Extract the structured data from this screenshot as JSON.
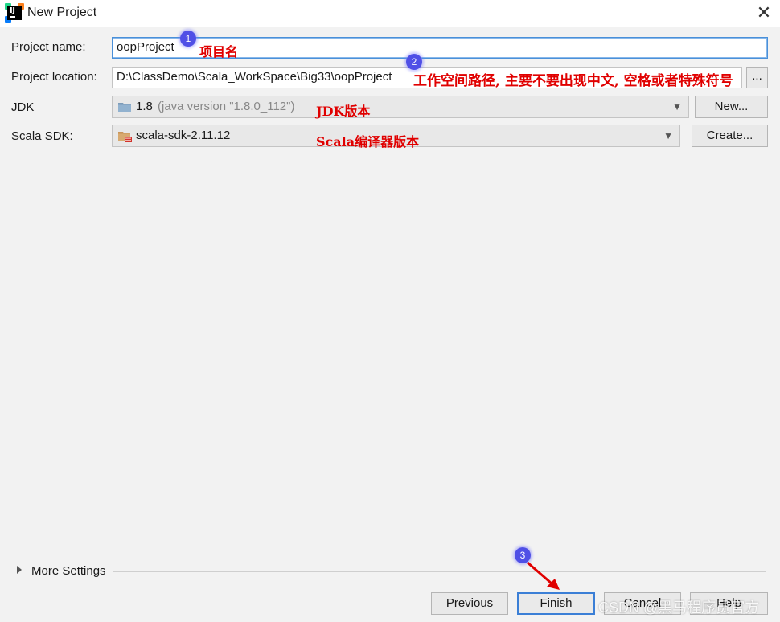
{
  "window": {
    "title": "New Project",
    "close_glyph": "✕"
  },
  "form": {
    "project_name_label": "Project name:",
    "project_name_value": "oopProject",
    "project_location_label": "Project location:",
    "project_location_value": "D:\\ClassDemo\\Scala_WorkSpace\\Big33\\oopProject",
    "browse_label": "...",
    "jdk_label": "JDK",
    "jdk_version": "1.8",
    "jdk_detail": "(java version \"1.8.0_112\")",
    "jdk_new_button": "New...",
    "scala_sdk_label": "Scala SDK:",
    "scala_sdk_value": "scala-sdk-2.11.12",
    "scala_create_button": "Create..."
  },
  "annotations": {
    "badge_1": "1",
    "badge_2": "2",
    "badge_3": "3",
    "note_name": "项目名",
    "note_location": "工作空间路径, 主要不要出现中文, 空格或者特殊符号",
    "note_jdk": "JDK版本",
    "note_scala": "Scala编译器版本",
    "color": "#e00000"
  },
  "more_settings": {
    "label": "More Settings"
  },
  "footer": {
    "previous": "Previous",
    "finish": "Finish",
    "cancel": "Cancel",
    "help": "Help"
  },
  "watermark": "CSDN @黑马程序员官方",
  "icons": [
    "intellij-logo",
    "close-icon",
    "jdk-folder-icon",
    "scala-sdk-folder-icon",
    "expand-triangle-icon",
    "red-arrow"
  ],
  "colors": {
    "accent": "#3b7fd6",
    "badge": "#5050e6",
    "annotation": "#e00000"
  }
}
